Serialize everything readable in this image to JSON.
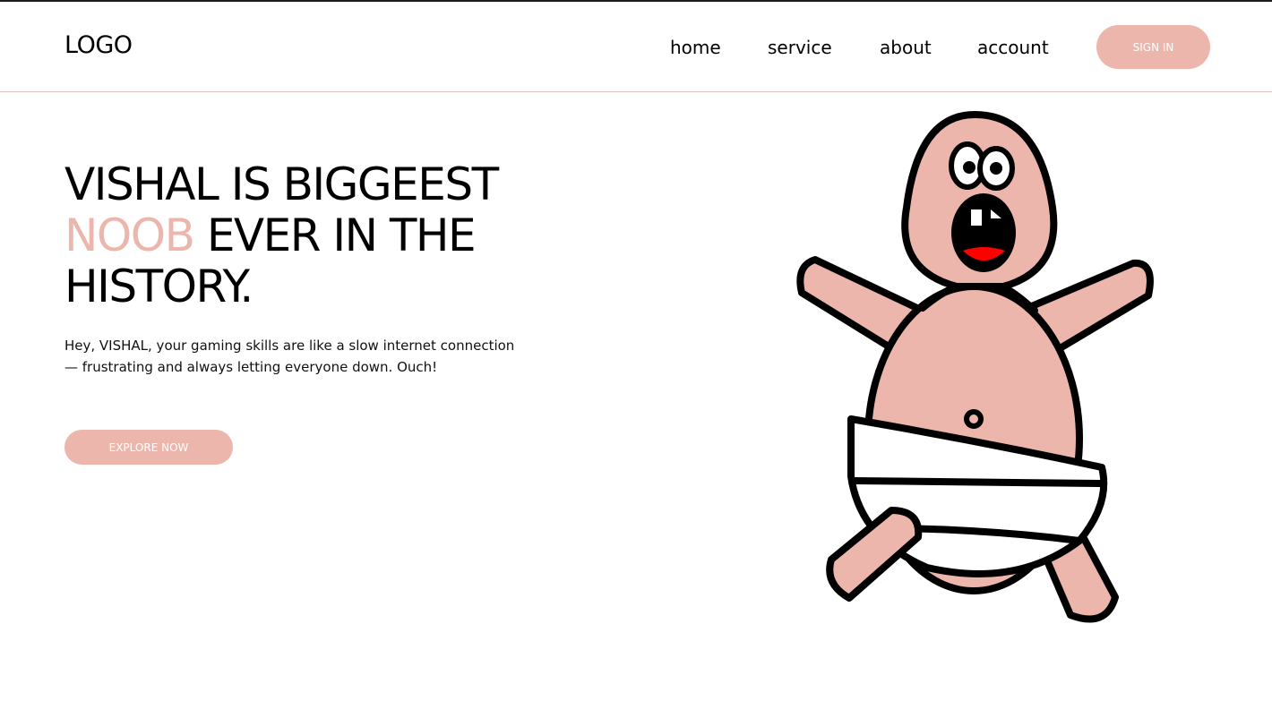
{
  "header": {
    "logo": "LOGO",
    "nav": {
      "home": "home",
      "service": "service",
      "about": "about",
      "account": "account"
    },
    "signin_label": "SIGN IN"
  },
  "hero": {
    "headline": {
      "line1": "VISHAL IS BIGGEEST",
      "accent_word": "NOOB",
      "line2_rest": " EVER IN THE",
      "line3": "HISTORY."
    },
    "description": "Hey, VISHAL, your gaming skills are like a slow internet connection — frustrating and always letting everyone down. Ouch!",
    "cta_label": "EXPLORE NOW"
  },
  "theme": {
    "accent": "#ecb6ac",
    "text": "#000000",
    "divider": "#e6c5bb",
    "mouth_tongue": "#ff0000"
  },
  "icons": {
    "illustration": "cartoon-baby-illustration"
  }
}
